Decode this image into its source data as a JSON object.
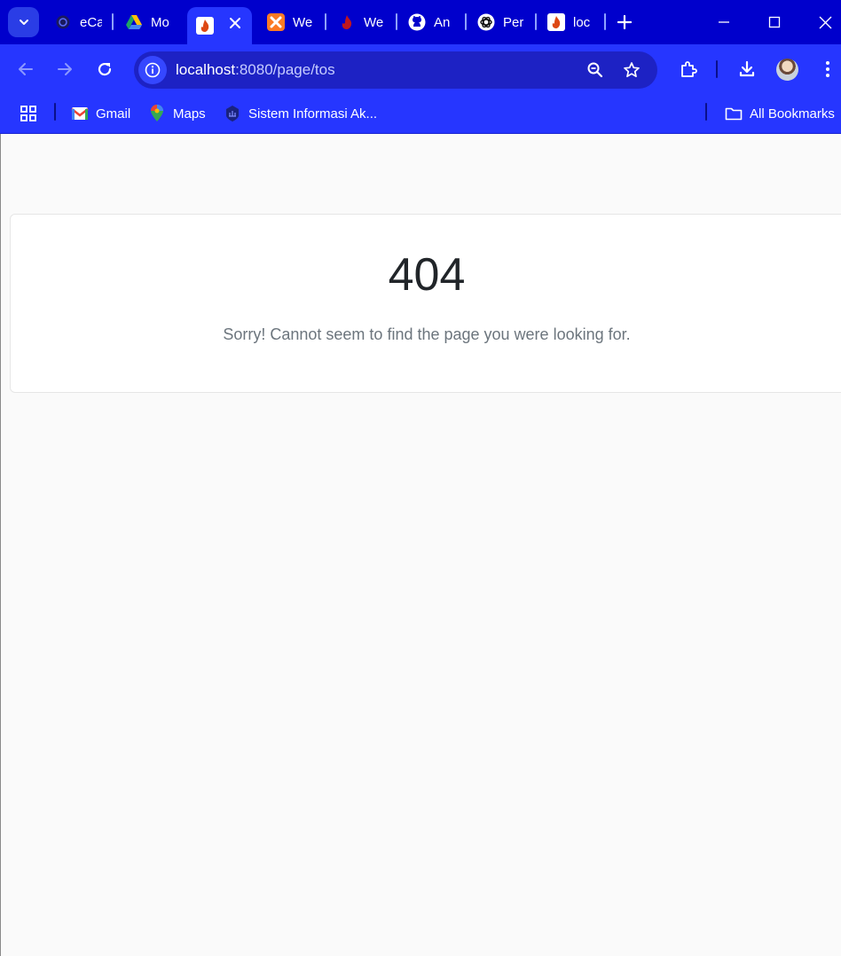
{
  "browser": {
    "tabs": [
      {
        "title": "eCa",
        "icon": "dark-seal-icon",
        "active": false
      },
      {
        "title": "Mo",
        "icon": "google-drive-icon",
        "active": false
      },
      {
        "title": "",
        "icon": "codeigniter-flame-icon",
        "active": true
      },
      {
        "title": "We",
        "icon": "xampp-icon",
        "active": false
      },
      {
        "title": "We",
        "icon": "codeigniter-flame-icon",
        "active": false
      },
      {
        "title": "An",
        "icon": "github-icon",
        "active": false
      },
      {
        "title": "Per",
        "icon": "openai-icon",
        "active": false
      },
      {
        "title": "loc",
        "icon": "codeigniter-flame-icon",
        "active": false
      }
    ],
    "address": {
      "host": "localhost",
      "path": ":8080/page/tos"
    },
    "bookmarks": [
      {
        "label": "Gmail",
        "icon": "gmail-icon"
      },
      {
        "label": "Maps",
        "icon": "google-maps-icon"
      },
      {
        "label": "Sistem Informasi Ak...",
        "icon": "university-seal-icon"
      }
    ],
    "all_bookmarks_label": "All Bookmarks",
    "colors": {
      "tabstrip": "#0000cc",
      "toolbar": "#2636ff",
      "omnibox": "#1d22c4"
    }
  },
  "page": {
    "error_code": "404",
    "error_message": "Sorry! Cannot seem to find the page you were looking for.",
    "background": "#fafafa"
  }
}
